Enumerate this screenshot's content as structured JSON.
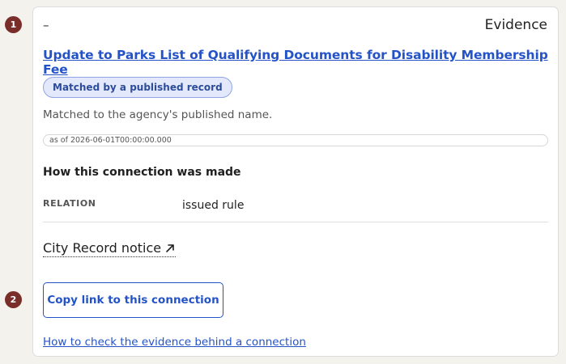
{
  "steps": [
    {
      "number": "1"
    },
    {
      "number": "2"
    }
  ],
  "panel": {
    "collapse_symbol": "–",
    "heading": "Evidence",
    "record_title": "Update to Parks List of Qualifying Documents for Disability Membership Fee",
    "match_badge": "Matched by a published record",
    "match_description": "Matched to the agency's published name.",
    "as_of": "as of 2026-06-01T00:00:00.000",
    "connection_section_title": "How this connection was made",
    "relation": {
      "key": "RELATION",
      "value": "issued rule"
    },
    "source_link": {
      "label": "City Record notice",
      "icon": "external-link-arrow-icon"
    },
    "copy_button_label": "Copy link to this connection",
    "help_link_label": "How to check the evidence behind a connection"
  },
  "colors": {
    "step_badge": "#7a2e2a",
    "link": "#2453c8",
    "badge_bg": "#e3e9fb",
    "badge_border": "#8fa6e6"
  }
}
